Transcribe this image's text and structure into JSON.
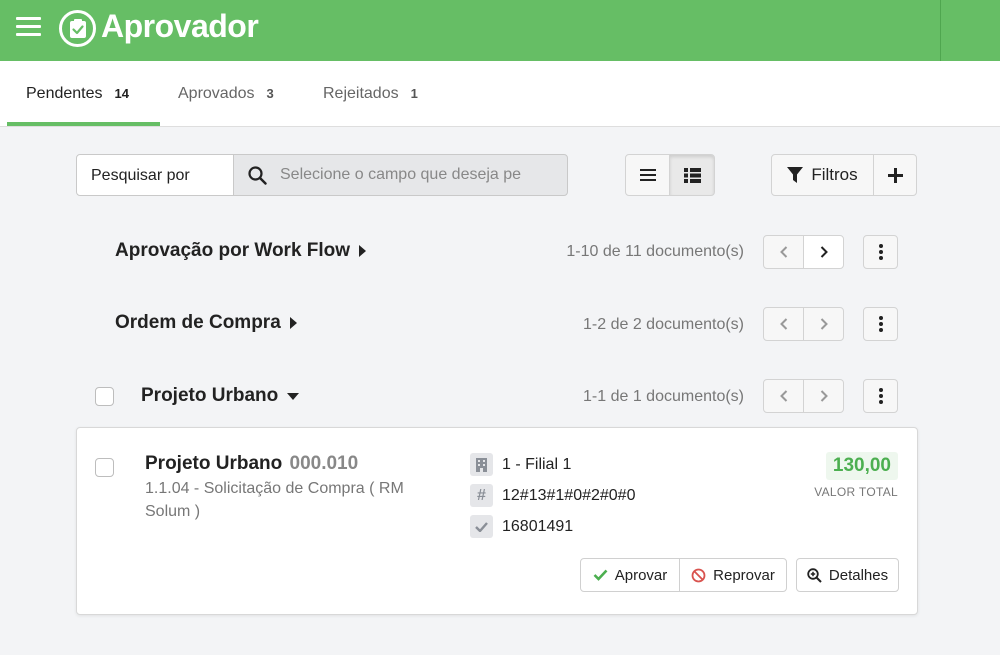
{
  "app": {
    "title": "Aprovador"
  },
  "tabs": [
    {
      "label": "Pendentes",
      "count": "14"
    },
    {
      "label": "Aprovados",
      "count": "3"
    },
    {
      "label": "Rejeitados",
      "count": "1"
    }
  ],
  "search": {
    "field_label": "Pesquisar por",
    "placeholder": "Selecione o campo que deseja pe"
  },
  "toolbar": {
    "filters_label": "Filtros"
  },
  "groups": [
    {
      "title": "Aprovação por Work Flow",
      "count": "1-10 de 11 documento(s)"
    },
    {
      "title": "Ordem de Compra",
      "count": "1-2 de 2 documento(s)"
    },
    {
      "title": "Projeto Urbano",
      "count": "1-1 de 1 documento(s)"
    }
  ],
  "card": {
    "title": "Projeto Urbano",
    "code": "000.010",
    "subtitle": "1.1.04 - Solicitação de Compra ( RM Solum )",
    "branch": "1 - Filial 1",
    "key": "12#13#1#0#2#0#0",
    "id": "16801491",
    "value": "130,00",
    "value_label": "VALOR TOTAL",
    "approve_label": "Aprovar",
    "reject_label": "Reprovar",
    "details_label": "Detalhes"
  },
  "colors": {
    "brand": "#66be65",
    "approve_icon": "#4caf50",
    "reject_icon": "#d9534f"
  }
}
